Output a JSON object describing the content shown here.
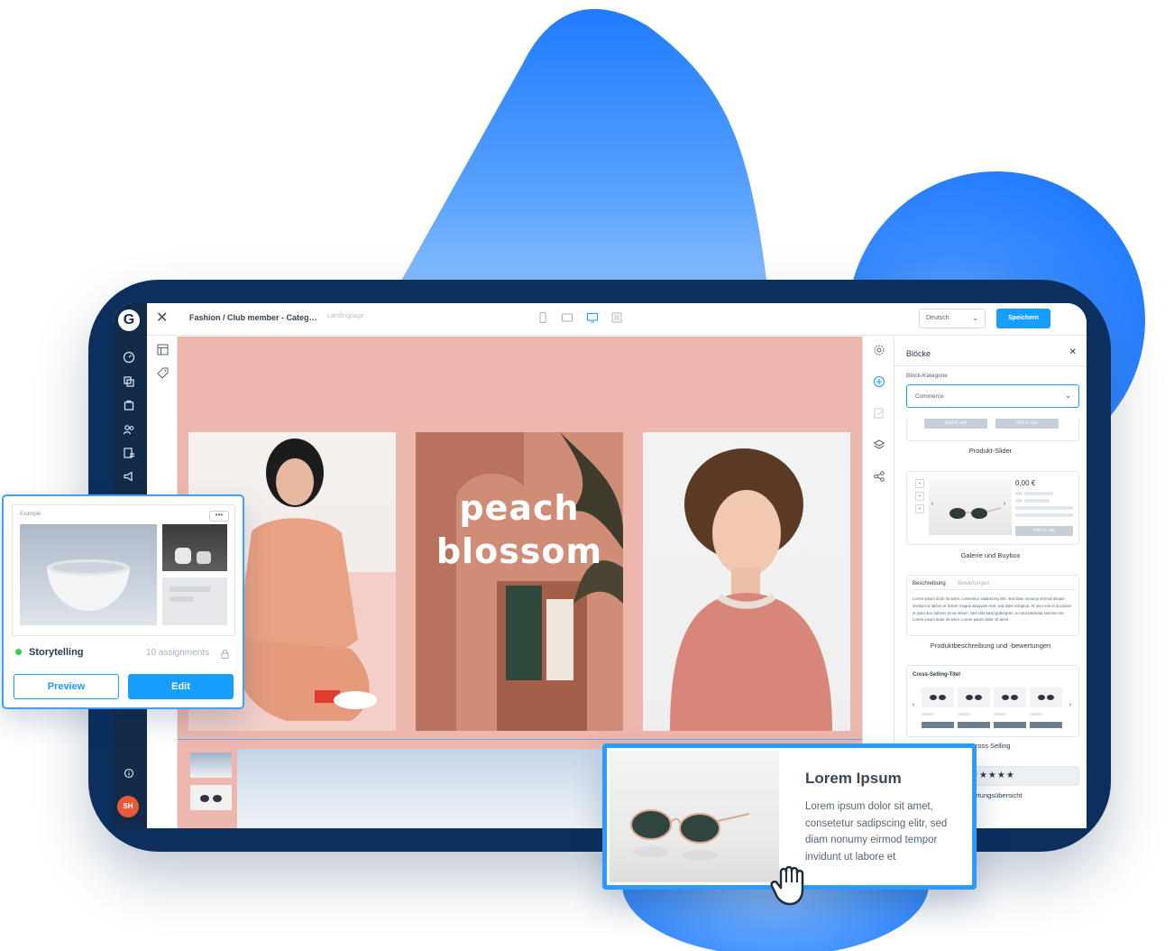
{
  "colors": {
    "accent": "#189eff",
    "navy": "#0d2f5d",
    "canvas_bg": "#edb7ad",
    "status_active": "#37d046",
    "avatar_bg": "#e8593a"
  },
  "sidebar": {
    "logo_letter": "G",
    "avatar_initials": "SH",
    "icons": [
      "dashboard-icon",
      "catalogue-icon",
      "orders-icon",
      "customers-icon",
      "content-icon",
      "marketing-icon",
      "info-icon"
    ]
  },
  "topbar": {
    "breadcrumb": "Fashion / Club member - Categ…",
    "page_type": "Landingpage",
    "language": "Deutsch",
    "save_label": "Speichern"
  },
  "canvas": {
    "headline": "peach blossom"
  },
  "blocks_panel": {
    "title": "Blöcke",
    "category_label": "Block-Kategorie",
    "category_value": "Commerce",
    "blocks": [
      {
        "name": "Produkt-Slider",
        "buttons": [
          "Add to cart",
          "Add to cart"
        ]
      },
      {
        "name": "Galerie und Buybox",
        "price": "0,00 €",
        "button": "Add to cart"
      },
      {
        "name": "Produktbeschreibung und -bewertungen",
        "tabs": [
          "Beschreibung",
          "Bewertungen"
        ],
        "text": "Lorem ipsum dolor sit amet, consetetur sadipscing elitr, sed diam nonumy eirmod tempor invidunt ut labore et dolore magna aliquyam erat, sed diam voluptua. At vero eos et accusam et justo duo dolores et ea rebum. Stet clita kasd gubergren, no sea takimata sanctus est Lorem ipsum dolor sit amet. Lorem ipsum dolor sit amet."
      },
      {
        "name": "Cross Selling",
        "title": "Cross-Selling-Titel"
      },
      {
        "name": "Bewertungsübersicht",
        "stars": "★★★★★"
      }
    ]
  },
  "story_card": {
    "example_label": "Example",
    "more": "•••",
    "name": "Storytelling",
    "assignments": "10 assignments",
    "preview_label": "Preview",
    "edit_label": "Edit"
  },
  "lorem_card": {
    "title": "Lorem Ipsum",
    "text": "Lorem ipsum dolor sit amet, consetetur sadipscing elitr, sed diam nonumy eirmod tempor invidunt ut labore et"
  }
}
